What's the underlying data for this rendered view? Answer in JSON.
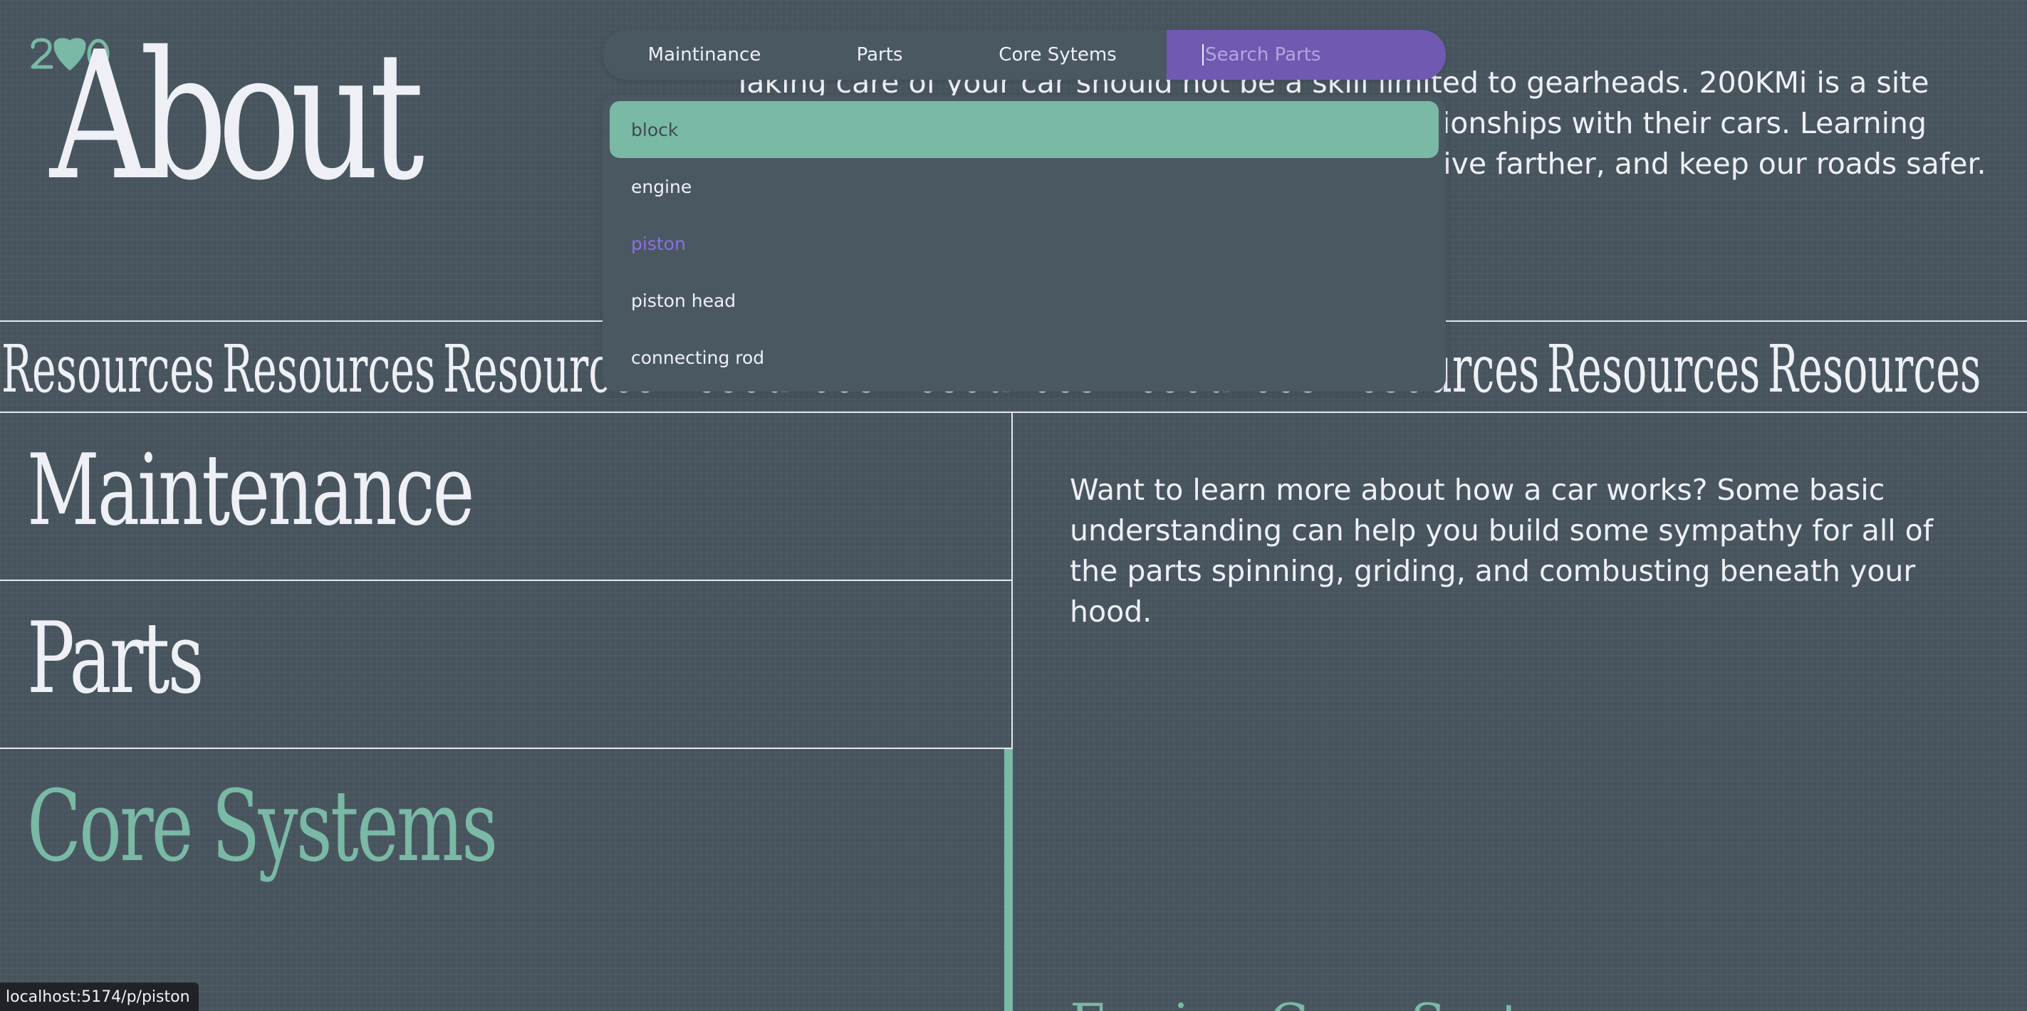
{
  "header": {
    "title": "About",
    "intro": "Taking care of your car should not be a skill limited to gearheads. 200KMi is a site dedicated to helping drivers build healthier relationships with their cars. Learning basic maintenance can help you save money, drive farther, and keep our roads safer."
  },
  "nav": {
    "items": [
      "Maintinance",
      "Parts",
      "Core Sytems"
    ],
    "search_placeholder": "Search Parts"
  },
  "dropdown": {
    "items": [
      "block",
      "engine",
      "piston",
      "piston head",
      "connecting rod"
    ],
    "highlighted": "block",
    "hovered": "piston"
  },
  "band": {
    "word": "Resources",
    "repeat_count": 9
  },
  "categories": [
    {
      "label": "Maintenance",
      "active": false
    },
    {
      "label": "Parts",
      "active": false
    },
    {
      "label": "Core Systems",
      "active": true
    }
  ],
  "learn_text": "Want to learn more about how a car works? Some basic understanding can help you build some sympathy for all of the parts spinning, griding, and combusting beneath your hood.",
  "partial_heading": "Engine Core Systems",
  "status_url": "localhost:5174/p/piston",
  "colors": {
    "background": "#47545e",
    "accent_green": "#7ab9a5",
    "accent_purple": "#7059b0",
    "hover_purple": "#8e6ee8",
    "text": "#eef0f6"
  },
  "icons": {
    "logo": "200-heart-logo"
  }
}
